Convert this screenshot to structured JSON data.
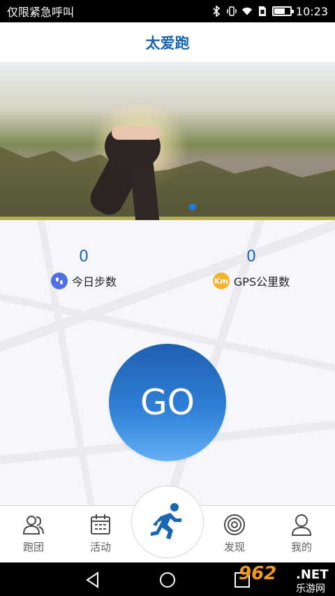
{
  "status_bar": {
    "carrier_text": "仅限紧急呼叫",
    "time": "10:23",
    "battery_level": 0.7,
    "icons": [
      "bluetooth-icon",
      "vibrate-icon",
      "wifi-icon",
      "sim-icon",
      "battery-icon"
    ]
  },
  "header": {
    "title": "太爱跑"
  },
  "banner": {
    "page_count": 1,
    "active_page": 1
  },
  "stats": {
    "steps": {
      "value": "0",
      "label": "今日步数",
      "icon": "footprint-icon",
      "color": "#4f6ee8"
    },
    "gps": {
      "value": "0",
      "label": "GPS公里数",
      "icon": "km-icon",
      "icon_text": "Km",
      "color": "#f6b330"
    }
  },
  "go_button": {
    "label": "GO"
  },
  "tabbar": {
    "items": [
      {
        "label": "跑团",
        "icon": "group-icon"
      },
      {
        "label": "活动",
        "icon": "calendar-icon"
      },
      {
        "label": "",
        "icon": "runner-icon"
      },
      {
        "label": "发现",
        "icon": "target-icon"
      },
      {
        "label": "我的",
        "icon": "person-icon"
      }
    ]
  },
  "watermark": {
    "text": "962",
    "net": ".NET",
    "sub": "乐游网"
  },
  "colors": {
    "accent": "#1a66b2",
    "go_top": "#1f5fb1",
    "go_bottom": "#64aff5"
  }
}
